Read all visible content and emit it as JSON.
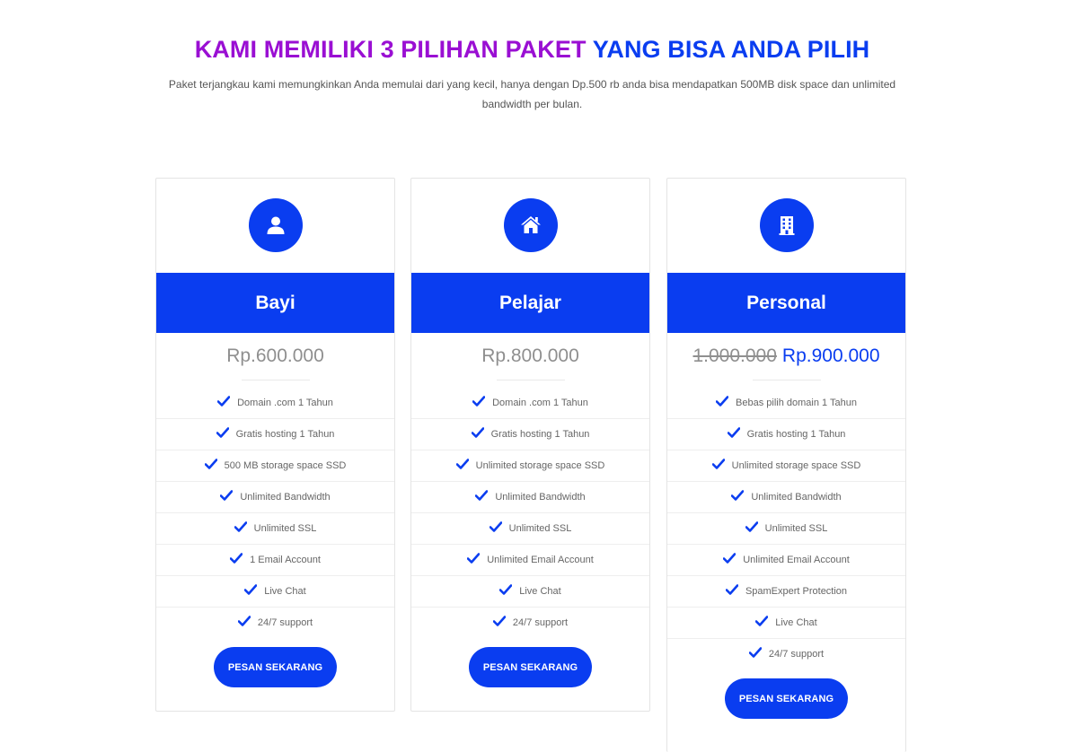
{
  "header": {
    "title_part1": "KAMI MEMILIKI 3 PILIHAN PAKET",
    "title_part2": "YANG BISA ANDA PILIH",
    "subtitle": "Paket terjangkau kami memungkinkan Anda memulai dari yang kecil, hanya dengan Dp.500 rb anda bisa mendapatkan 500MB disk space dan unlimited bandwidth per bulan."
  },
  "colors": {
    "accent": "#0a3df0",
    "title_purple": "#9a0fd3"
  },
  "plans": [
    {
      "icon": "user-icon",
      "name": "Bayi",
      "price": "Rp.600.000",
      "features": [
        "Domain .com 1 Tahun",
        "Gratis hosting 1 Tahun",
        "500 MB storage space SSD",
        "Unlimited Bandwidth",
        "Unlimited SSL",
        "1 Email Account",
        "Live Chat",
        "24/7 support"
      ],
      "button": "PESAN SEKARANG"
    },
    {
      "icon": "home-icon",
      "name": "Pelajar",
      "price": "Rp.800.000",
      "features": [
        "Domain .com 1 Tahun",
        "Gratis hosting 1 Tahun",
        "Unlimited storage space SSD",
        "Unlimited Bandwidth",
        "Unlimited SSL",
        "Unlimited Email Account",
        "Live Chat",
        "24/7 support"
      ],
      "button": "PESAN SEKARANG"
    },
    {
      "icon": "building-icon",
      "name": "Personal",
      "price_old": "1.000.000",
      "price": "Rp.900.000",
      "features": [
        "Bebas pilih domain 1 Tahun",
        "Gratis hosting 1 Tahun",
        "Unlimited storage space SSD",
        "Unlimited Bandwidth",
        "Unlimited SSL",
        "Unlimited Email Account",
        "SpamExpert Protection",
        "Live Chat",
        "24/7 support"
      ],
      "button": "PESAN SEKARANG"
    }
  ]
}
